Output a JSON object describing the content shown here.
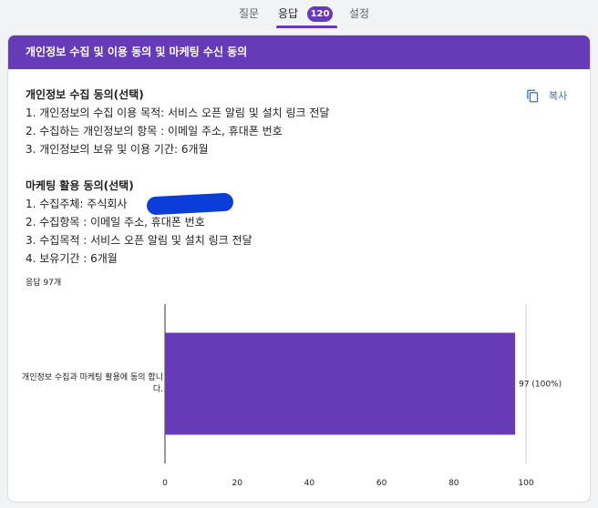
{
  "tabs": {
    "questions": "질문",
    "responses": "응답",
    "responses_badge": "120",
    "settings": "설정"
  },
  "card": {
    "title": "개인정보 수집 및 이용 동의 및 마케팅 수신 동의",
    "copy_label": "복사",
    "sections": [
      {
        "heading": "개인정보 수집 동의(선택)",
        "lines": [
          "1. 개인정보의 수집 이용 목적: 서비스 오픈 알림 및 설치 링크 전달",
          "2. 수집하는 개인정보의 항목 : 이메일 주소, 휴대폰 번호",
          "3. 개인정보의 보유 및 이용 기간: 6개월"
        ]
      },
      {
        "heading": "마케팅 활용 동의(선택)",
        "lines": [
          "1. 수집주체: 주식회사",
          "2. 수집항목 : 이메일 주소, 휴대폰 번호",
          "3. 수집목적 : 서비스 오픈 알림 및 설치 링크 전달",
          "4. 보유기간 : 6개월"
        ]
      }
    ],
    "response_count": "응답 97개"
  },
  "chart_data": {
    "type": "bar",
    "orientation": "horizontal",
    "categories": [
      "개인정보 수집과 마케팅 활용에 동의 합니다."
    ],
    "values": [
      97
    ],
    "value_labels": [
      "97 (100%)"
    ],
    "xlim": [
      0,
      100
    ],
    "xticks": [
      0,
      20,
      40,
      60,
      80,
      100
    ],
    "bar_color": "#673ab7",
    "grid": false
  },
  "colors": {
    "accent": "#673ab7",
    "link": "#1a73e8"
  }
}
